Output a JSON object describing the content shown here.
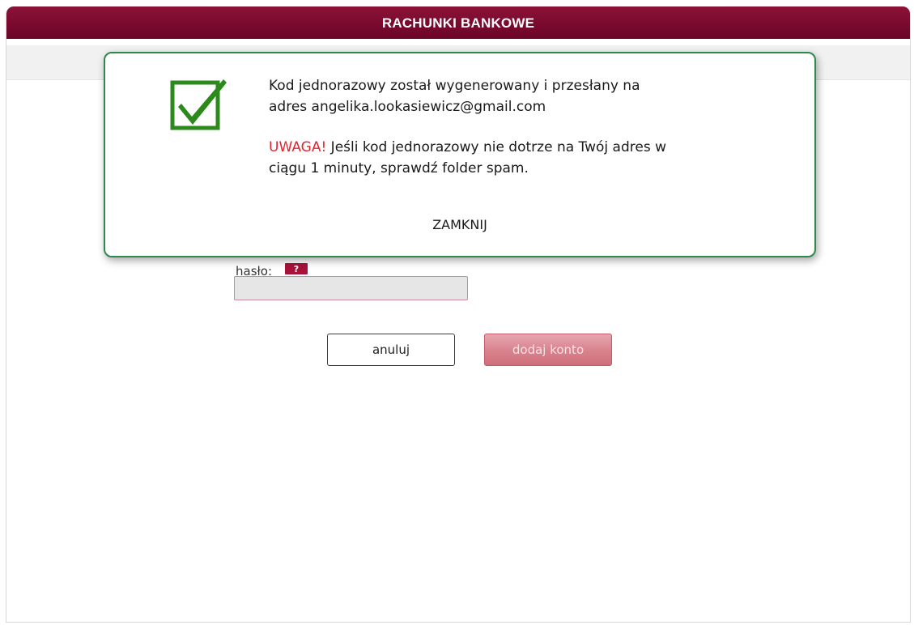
{
  "header": {
    "title": "RACHUNKI BANKOWE"
  },
  "form": {
    "password_label": "hasło:",
    "help_badge": "?",
    "password_value": "",
    "cancel_label": "anuluj",
    "add_label": "dodaj konto"
  },
  "modal": {
    "icon": "checkmark-icon",
    "line1": "Kod jednorazowy został wygenerowany i przesłany na",
    "line2": "adres angelika.lookasiewicz@gmail.com",
    "warning_word": "UWAGA!",
    "warning_line1_rest": " Jeśli kod jednorazowy nie dotrze na Twój adres w",
    "warning_line2": "ciągu 1 minuty, sprawdź folder spam.",
    "close_label": "ZAMKNIJ"
  },
  "colors": {
    "header": "#7a0a2f",
    "modal_border": "#2e8a4a",
    "warning": "#e2252f",
    "check": "#2c8a1c"
  }
}
